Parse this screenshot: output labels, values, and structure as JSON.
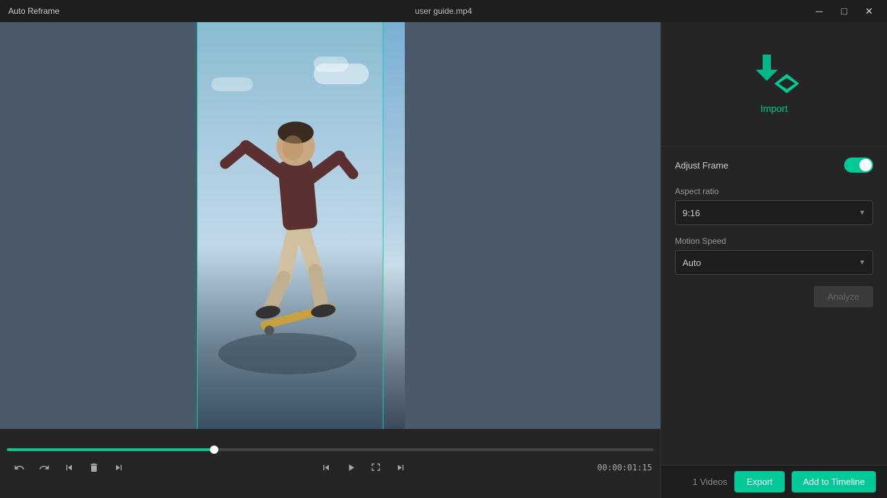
{
  "app": {
    "title": "Auto Reframe",
    "file_name": "user guide.mp4"
  },
  "titlebar": {
    "minimize_label": "minimize",
    "maximize_label": "maximize",
    "close_label": "close",
    "min_icon": "─",
    "max_icon": "□",
    "close_icon": "✕"
  },
  "import": {
    "label": "Import"
  },
  "settings": {
    "adjust_frame_label": "Adjust Frame",
    "aspect_ratio_label": "Aspect ratio",
    "aspect_ratio_value": "9:16",
    "motion_speed_label": "Motion Speed",
    "motion_speed_value": "Auto",
    "analyze_label": "Analyze",
    "adjust_frame_enabled": true
  },
  "player": {
    "time_display": "00:00:01:15",
    "progress_percent": 32
  },
  "footer": {
    "video_count": "1 Videos",
    "export_label": "Export",
    "add_timeline_label": "Add to Timeline"
  },
  "controls": {
    "undo": "↩",
    "redo": "↪",
    "skip_back": "⏮",
    "delete": "🗑",
    "skip_end": "⏭",
    "prev_frame": "⏪",
    "play": "▶",
    "full": "⛶",
    "next_frame": "⏩"
  }
}
